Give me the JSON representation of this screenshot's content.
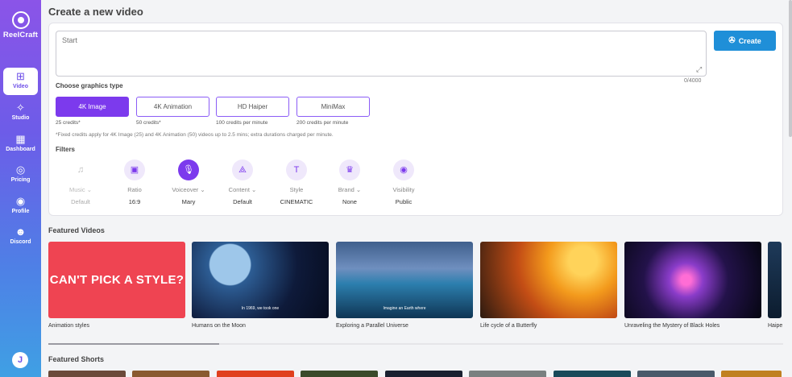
{
  "sidebar": {
    "logo": "ReelCraft",
    "items": [
      {
        "label": "Video",
        "icon": "plus-square-icon"
      },
      {
        "label": "Studio",
        "icon": "magic-wand-icon"
      },
      {
        "label": "Dashboard",
        "icon": "grid-icon"
      },
      {
        "label": "Pricing",
        "icon": "dollar-circle-icon"
      },
      {
        "label": "Profile",
        "icon": "user-circle-icon"
      },
      {
        "label": "Discord",
        "icon": "discord-icon"
      }
    ],
    "avatar_initial": "J"
  },
  "page_title": "Create a new video",
  "prompt": {
    "placeholder": "Start",
    "value": "",
    "counter": "0/4000"
  },
  "create_label": "Create",
  "graphics": {
    "label": "Choose graphics type",
    "options": [
      {
        "label": "4K Image",
        "credits": "25 credits*",
        "active": true
      },
      {
        "label": "4K Animation",
        "credits": "50 credits*",
        "active": false
      },
      {
        "label": "HD Haiper",
        "credits": "100 credits per minute",
        "active": false
      },
      {
        "label": "MiniMax",
        "credits": "200 credits per minute",
        "active": false
      }
    ],
    "note": "*Fixed credits apply for 4K Image (25) and 4K Animation (50) videos up to 2.5 mins; extra durations charged per minute."
  },
  "filters": {
    "label": "Filters",
    "items": [
      {
        "name": "Music",
        "value": "Default",
        "icon": "music-note-icon",
        "dropdown": true
      },
      {
        "name": "Ratio",
        "value": "16:9",
        "icon": "ratio-frame-icon",
        "dropdown": false
      },
      {
        "name": "Voiceover",
        "value": "Mary",
        "icon": "microphone-icon",
        "dropdown": true
      },
      {
        "name": "Content",
        "value": "Default",
        "icon": "shapes-icon",
        "dropdown": true
      },
      {
        "name": "Style",
        "value": "CINEMATIC",
        "icon": "text-style-icon",
        "dropdown": false
      },
      {
        "name": "Brand",
        "value": "None",
        "icon": "brand-icon",
        "dropdown": true
      },
      {
        "name": "Visibility",
        "value": "Public",
        "icon": "eye-icon",
        "dropdown": false
      }
    ]
  },
  "featured_videos": {
    "title": "Featured Videos",
    "items": [
      {
        "caption": "Animation styles",
        "thumb_text": "CAN'T PICK A STYLE?"
      },
      {
        "caption": "Humans on the Moon",
        "thumb_text": "In 1969, we took one"
      },
      {
        "caption": "Exploring a Parallel Universe",
        "thumb_text": "Imagine an Earth where"
      },
      {
        "caption": "Life cycle of a Butterfly",
        "thumb_text": ""
      },
      {
        "caption": "Unraveling the Mystery of Black Holes",
        "thumb_text": ""
      },
      {
        "caption": "Haipe",
        "thumb_text": ""
      }
    ]
  },
  "featured_shorts": {
    "title": "Featured Shorts"
  },
  "colors": {
    "accent": "#7c3aed",
    "create_button": "#1f8fd8",
    "sidebar_top": "#8b54e8",
    "sidebar_bottom": "#3fa0e4"
  }
}
